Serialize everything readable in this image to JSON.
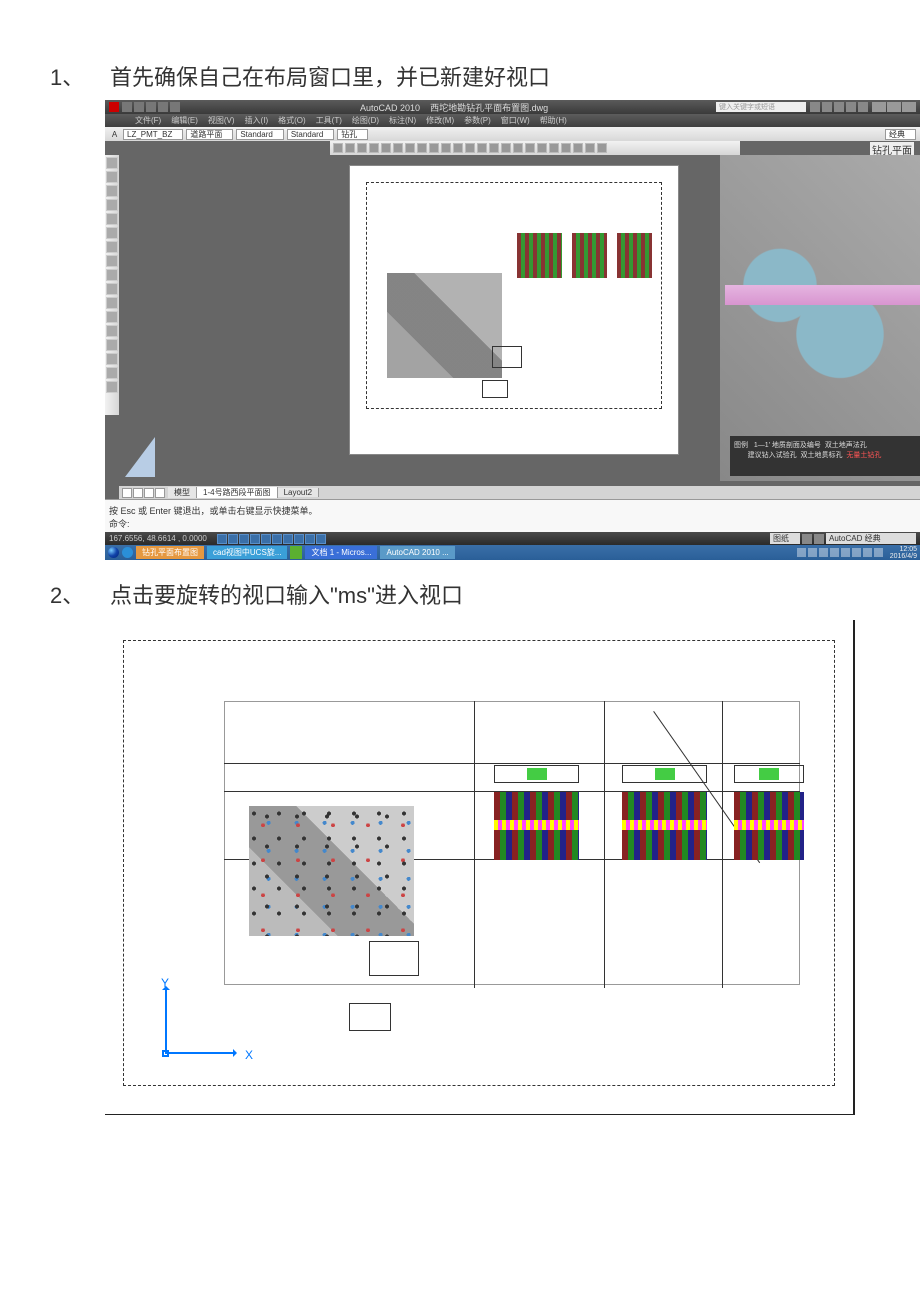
{
  "steps": {
    "s1_num": "1、",
    "s1_txt": "首先确保自己在布局窗口里，并已新建好视口",
    "s2_num": "2、",
    "s2_txt": "点击要旋转的视口输入\"ms\"进入视口"
  },
  "acad": {
    "app": "AutoCAD 2010",
    "doc": "西坨地勘钻孔平面布置图.dwg",
    "search_placeholder": "键入关键字或短语",
    "menus": [
      "文件(F)",
      "编辑(E)",
      "视图(V)",
      "插入(I)",
      "格式(O)",
      "工具(T)",
      "绘图(D)",
      "标注(N)",
      "修改(M)",
      "参数(P)",
      "窗口(W)",
      "帮助(H)"
    ],
    "layers": {
      "lineweight_icon": "A",
      "layer": "LZ_PMT_BZ",
      "layer2": "道路平面",
      "style1": "Standard",
      "style2": "Standard",
      "layer3": "钻孔",
      "workspace": "经典"
    },
    "corner_label": "钻孔平面",
    "tabs": {
      "t1": "模型",
      "t2": "1-4号路西段平面图",
      "t3": "Layout2"
    },
    "cmd": {
      "line1": "按 Esc 或 Enter 键退出，或单击右键显示快捷菜单。",
      "prompt": "命令:"
    },
    "status": {
      "coords": "167.6556, 48.6614 , 0.0000",
      "space": "图纸",
      "ws_label": "AutoCAD 经典"
    },
    "legend": {
      "title": "图例",
      "items": [
        "1—1' 地质剖面及编号",
        "建议钻入试验孔",
        "双土地声法孔",
        "双土地贯标孔",
        "无量土钻孔"
      ]
    }
  },
  "taskbar": {
    "t1": "钻孔平面布置图",
    "t2": "cad视图中UCS旋...",
    "t3": "",
    "t4": "文档 1 - Micros...",
    "t5": "AutoCAD 2010 ...",
    "time": "12:05",
    "date": "2016/4/9"
  },
  "ucs": {
    "x": "X",
    "y": "Y"
  }
}
